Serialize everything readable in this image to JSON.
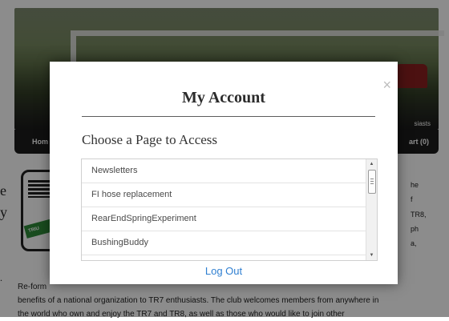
{
  "background": {
    "banner_tagline": "siasts",
    "nav": {
      "home": "Hom",
      "cart": "art (0)"
    },
    "logo_text": "TRIU",
    "left_fragments": [
      "e",
      "y",
      "."
    ],
    "right_fragments": [
      "he",
      "f",
      "TR8,",
      "ph",
      "a,"
    ],
    "body_lines": [
      "Re-form",
      "benefits of a national organization to TR7 enthusiasts. The club welcomes members from anywhere in",
      "the world who own and enjoy the TR7 and TR8, as well as those who would like to join other"
    ]
  },
  "modal": {
    "close_label": "×",
    "title": "My Account",
    "subtitle": "Choose a Page to Access",
    "pages": [
      "Newsletters",
      "FI hose replacement",
      "RearEndSpringExperiment",
      "BushingBuddy"
    ],
    "logout_label": "Log Out",
    "colors": {
      "link": "#2f7fd1",
      "overlay": "rgba(0,0,0,0.45)"
    }
  }
}
